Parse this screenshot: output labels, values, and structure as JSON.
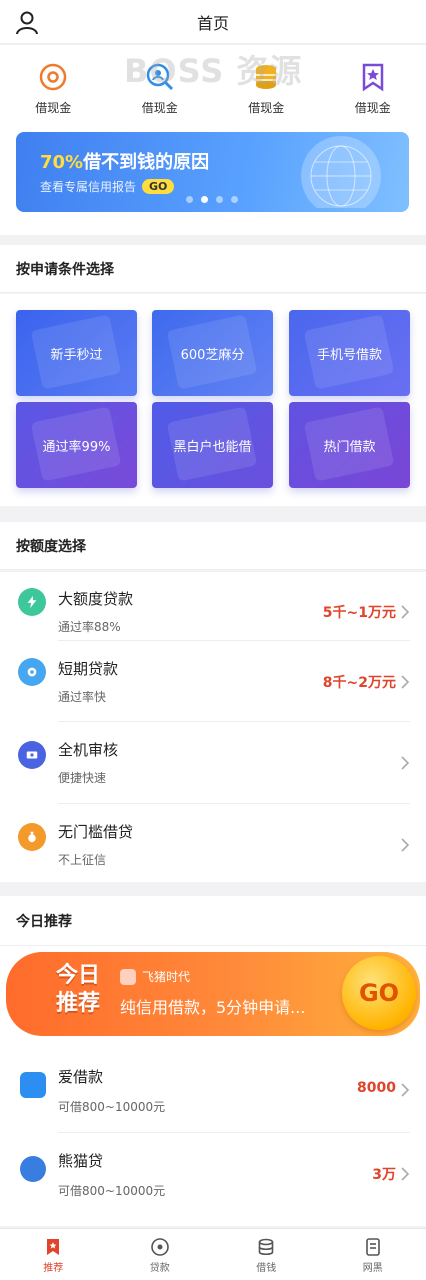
{
  "header": {
    "title": "首页",
    "watermark": "BOSS 资源"
  },
  "quick_entries": [
    {
      "label": "借现金",
      "icon": "orange-target-icon",
      "color": "#f07a2c"
    },
    {
      "label": "借现金",
      "icon": "search-coin-icon",
      "color": "#2f8fe8"
    },
    {
      "label": "借现金",
      "icon": "coin-stack-icon",
      "color": "#f3b21c"
    },
    {
      "label": "借现金",
      "icon": "bookmark-star-icon",
      "color": "#7a4ad8"
    }
  ],
  "banner": {
    "highlight": "70%",
    "title_rest": "借不到钱的原因",
    "subtitle": "查看专属信用报告",
    "go": "GO",
    "slides": 4,
    "active_slide": 2
  },
  "conditions": {
    "title": "按申请条件选择",
    "tiles": [
      "新手秒过",
      "600芝麻分",
      "手机号借款",
      "通过率99%",
      "黑白户也能借",
      "热门借款"
    ]
  },
  "amounts": {
    "title": "按额度选择",
    "items": [
      {
        "name": "大额度贷款",
        "sub": "通过率88%",
        "amount": "5千~1万元",
        "icon": "lightning-icon",
        "color": "#3dc79a"
      },
      {
        "name": "短期贷款",
        "sub": "通过率快",
        "amount": "8千~2万元",
        "icon": "clock-coin-icon",
        "color": "#46a6f0"
      },
      {
        "name": "全机审核",
        "sub": "便捷快速",
        "amount": "",
        "icon": "id-card-icon",
        "color": "#4a63e0"
      },
      {
        "name": "无门槛借贷",
        "sub": "不上征信",
        "amount": "",
        "icon": "money-bag-icon",
        "color": "#f39a2a"
      }
    ]
  },
  "recommend": {
    "title": "今日推荐",
    "badge_line1": "今日",
    "badge_line2": "推荐",
    "brand": "飞猪时代",
    "text": "纯信用借款，5分钟申请...",
    "go": "GO",
    "items": [
      {
        "name": "爱借款",
        "sub": "可借800~10000元",
        "amount": "8000",
        "logo_color": "#2b8ef0"
      },
      {
        "name": "熊猫贷",
        "sub": "可借800~10000元",
        "amount": "3万",
        "logo_color": "#3a7de0"
      }
    ]
  },
  "tabbar": {
    "tabs": [
      {
        "label": "推荐",
        "icon": "bookmark-star-icon",
        "active": true
      },
      {
        "label": "贷款",
        "icon": "circle-dot-icon",
        "active": false
      },
      {
        "label": "借钱",
        "icon": "coin-stack-icon",
        "active": false
      },
      {
        "label": "网黑",
        "icon": "document-icon",
        "active": false
      }
    ]
  },
  "colors": {
    "accent": "#e0442a",
    "tile_gradient_start": "#3f6bf0",
    "tile_gradient_end": "#7a4ad8"
  }
}
